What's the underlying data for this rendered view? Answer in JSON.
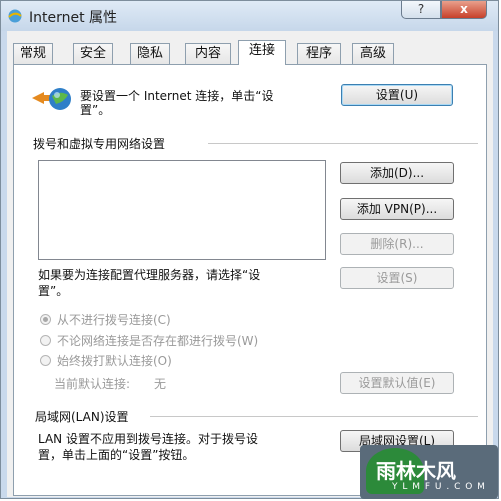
{
  "window": {
    "title": "Internet 属性",
    "help_label": "?",
    "close_label": "x"
  },
  "tabs": [
    {
      "label": "常规"
    },
    {
      "label": "安全"
    },
    {
      "label": "隐私"
    },
    {
      "label": "内容"
    },
    {
      "label": "连接",
      "active": true
    },
    {
      "label": "程序"
    },
    {
      "label": "高级"
    }
  ],
  "setup": {
    "text_line1": "要设置一个 Internet 连接，单击“设",
    "text_line2": "置”。",
    "button": "设置(U)"
  },
  "dialup": {
    "section_title": "拨号和虚拟专用网络设置",
    "add_button": "添加(D)...",
    "add_vpn_button": "添加 VPN(P)...",
    "remove_button": "删除(R)...",
    "proxy_text_line1": "如果要为连接配置代理服务器，请选择“设",
    "proxy_text_line2": "置”。",
    "settings_button": "设置(S)",
    "options": [
      {
        "label": "从不进行拨号连接(C)",
        "checked": true
      },
      {
        "label": "不论网络连接是否存在都进行拨号(W)",
        "checked": false
      },
      {
        "label": "始终拨打默认连接(O)",
        "checked": false
      }
    ],
    "current_default_label": "当前默认连接:",
    "current_default_value": "无",
    "set_default_button": "设置默认值(E)"
  },
  "lan": {
    "section_title": "局域网(LAN)设置",
    "text_line1": "LAN 设置不应用到拨号连接。对于拨号设",
    "text_line2": "置，单击上面的“设置”按钮。",
    "button": "局域网设置(L)"
  },
  "watermark": {
    "text": "雨林木风",
    "url": "Y L M F U . C O M"
  },
  "colors": {
    "accent": "#3c7fb1",
    "close": "#c7402a",
    "watermark_green": "#2c8a3a"
  }
}
